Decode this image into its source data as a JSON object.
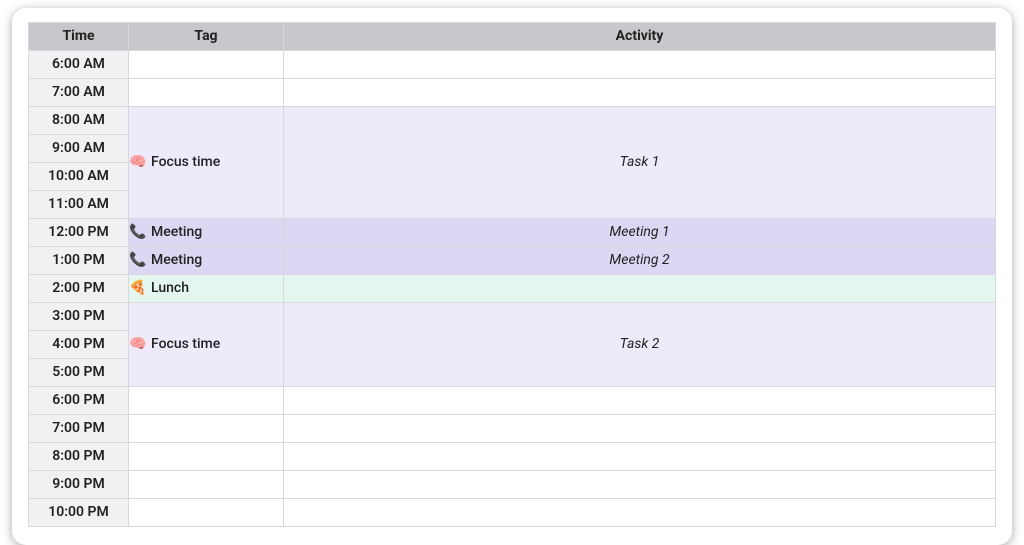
{
  "headers": {
    "time": "Time",
    "tag": "Tag",
    "activity": "Activity"
  },
  "times": [
    "6:00 AM",
    "7:00 AM",
    "8:00 AM",
    "9:00 AM",
    "10:00 AM",
    "11:00 AM",
    "12:00 PM",
    "1:00 PM",
    "2:00 PM",
    "3:00 PM",
    "4:00 PM",
    "5:00 PM",
    "6:00 PM",
    "7:00 PM",
    "8:00 PM",
    "9:00 PM",
    "10:00 PM"
  ],
  "tags": {
    "focus": {
      "icon": "🧠",
      "label": "Focus time"
    },
    "meeting": {
      "icon": "📞",
      "label": "Meeting"
    },
    "lunch": {
      "icon": "🍕",
      "label": "Lunch"
    }
  },
  "activities": {
    "task1": "Task 1",
    "meeting1": "Meeting 1",
    "meeting2": "Meeting 2",
    "task2": "Task 2"
  },
  "colors": {
    "header_bg": "#c7c8cc",
    "time_bg": "#f1f1f3",
    "focus_bg": "#efeaf9",
    "meeting_bg": "#ded7f4",
    "lunch_bg": "#e3f6f0",
    "border": "#d7d7dc"
  },
  "schedule": [
    {
      "time_idx": 0
    },
    {
      "time_idx": 1
    },
    {
      "time_idx": 2,
      "tag": "focus",
      "tag_span": 4,
      "activity": "task1",
      "activity_span": 4,
      "bg": "focus"
    },
    {
      "time_idx": 3
    },
    {
      "time_idx": 4
    },
    {
      "time_idx": 5
    },
    {
      "time_idx": 6,
      "tag": "meeting",
      "tag_span": 1,
      "activity": "meeting1",
      "activity_span": 1,
      "bg": "meeting"
    },
    {
      "time_idx": 7,
      "tag": "meeting",
      "tag_span": 1,
      "activity": "meeting2",
      "activity_span": 1,
      "bg": "meeting"
    },
    {
      "time_idx": 8,
      "tag": "lunch",
      "tag_span": 1,
      "activity": "",
      "activity_span": 1,
      "bg": "lunch"
    },
    {
      "time_idx": 9,
      "tag": "focus",
      "tag_span": 3,
      "activity": "task2",
      "activity_span": 3,
      "bg": "focus"
    },
    {
      "time_idx": 10
    },
    {
      "time_idx": 11
    },
    {
      "time_idx": 12
    },
    {
      "time_idx": 13
    },
    {
      "time_idx": 14
    },
    {
      "time_idx": 15
    },
    {
      "time_idx": 16
    }
  ]
}
